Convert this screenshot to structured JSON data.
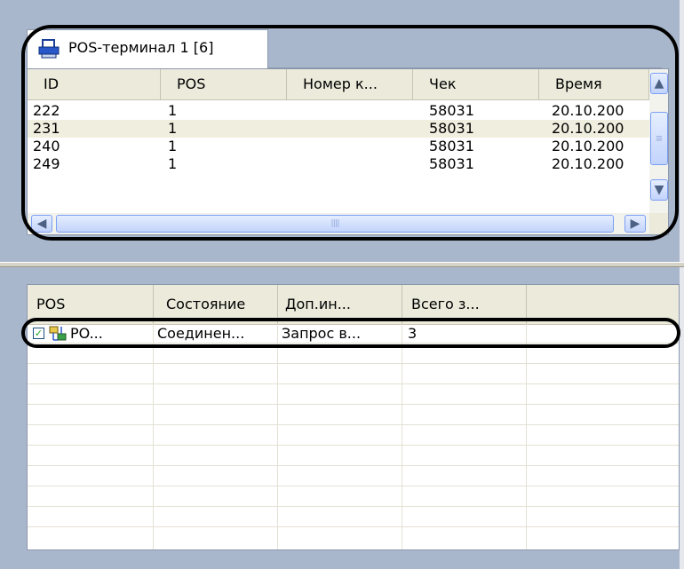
{
  "top_panel": {
    "tab_label": "POS-терминал 1 [6]",
    "tab_icon": "printer-icon",
    "columns": [
      "ID",
      "POS",
      "Номер к...",
      "Чек",
      "Время"
    ],
    "rows": [
      {
        "id": "222",
        "pos": "1",
        "number": "",
        "check": "58031",
        "time": "20.10.200"
      },
      {
        "id": "231",
        "pos": "1",
        "number": "",
        "check": "58031",
        "time": "20.10.200"
      },
      {
        "id": "240",
        "pos": "1",
        "number": "",
        "check": "58031",
        "time": "20.10.200"
      },
      {
        "id": "249",
        "pos": "1",
        "number": "",
        "check": "58031",
        "time": "20.10.200"
      }
    ],
    "selected_row_index": 1,
    "selected_row_color": "#f0eedf",
    "scrollbar_grip": "||||"
  },
  "bottom_panel": {
    "columns": [
      "POS",
      "Состояние",
      "Доп.ин...",
      "Всего з..."
    ],
    "rows": [
      {
        "pos": "PO...",
        "checked": true,
        "state": "Соединен...",
        "extra": "Запрос в...",
        "total": "3",
        "icon": "network-terminal-icon"
      }
    ]
  },
  "colors": {
    "panel_background": "#a9b7cc",
    "header_background": "#ebeadb",
    "scrollbar_accent": "#7b9ff5"
  }
}
